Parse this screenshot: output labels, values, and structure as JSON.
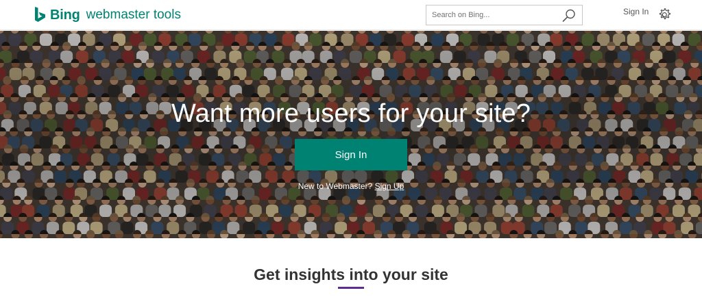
{
  "header": {
    "brand": "Bing",
    "product": "webmaster tools",
    "search_placeholder": "Search on Bing...",
    "signin_label": "Sign In",
    "icons": {
      "logo": "bing-logo-icon",
      "search": "search-icon",
      "settings": "gear-icon"
    },
    "brand_color": "#008373"
  },
  "hero": {
    "title": "Want more users for your site?",
    "button_label": "Sign In",
    "new_user_text": "New to Webmaster?",
    "signup_label": "Sign Up",
    "button_color": "#008272"
  },
  "insights": {
    "title": "Get insights into your site",
    "accent_color": "#5c2d91"
  }
}
